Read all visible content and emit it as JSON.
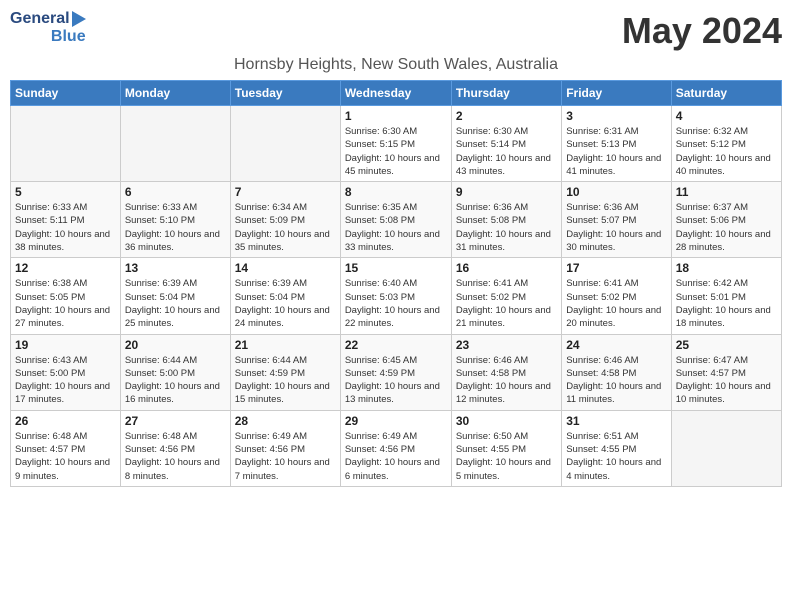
{
  "header": {
    "logo_line1": "General",
    "logo_line2": "Blue",
    "month_title": "May 2024",
    "location": "Hornsby Heights, New South Wales, Australia"
  },
  "weekdays": [
    "Sunday",
    "Monday",
    "Tuesday",
    "Wednesday",
    "Thursday",
    "Friday",
    "Saturday"
  ],
  "weeks": [
    [
      {
        "num": "",
        "empty": true
      },
      {
        "num": "",
        "empty": true
      },
      {
        "num": "",
        "empty": true
      },
      {
        "num": "1",
        "sunrise": "6:30 AM",
        "sunset": "5:15 PM",
        "daylight": "10 hours and 45 minutes."
      },
      {
        "num": "2",
        "sunrise": "6:30 AM",
        "sunset": "5:14 PM",
        "daylight": "10 hours and 43 minutes."
      },
      {
        "num": "3",
        "sunrise": "6:31 AM",
        "sunset": "5:13 PM",
        "daylight": "10 hours and 41 minutes."
      },
      {
        "num": "4",
        "sunrise": "6:32 AM",
        "sunset": "5:12 PM",
        "daylight": "10 hours and 40 minutes."
      }
    ],
    [
      {
        "num": "5",
        "sunrise": "6:33 AM",
        "sunset": "5:11 PM",
        "daylight": "10 hours and 38 minutes."
      },
      {
        "num": "6",
        "sunrise": "6:33 AM",
        "sunset": "5:10 PM",
        "daylight": "10 hours and 36 minutes."
      },
      {
        "num": "7",
        "sunrise": "6:34 AM",
        "sunset": "5:09 PM",
        "daylight": "10 hours and 35 minutes."
      },
      {
        "num": "8",
        "sunrise": "6:35 AM",
        "sunset": "5:08 PM",
        "daylight": "10 hours and 33 minutes."
      },
      {
        "num": "9",
        "sunrise": "6:36 AM",
        "sunset": "5:08 PM",
        "daylight": "10 hours and 31 minutes."
      },
      {
        "num": "10",
        "sunrise": "6:36 AM",
        "sunset": "5:07 PM",
        "daylight": "10 hours and 30 minutes."
      },
      {
        "num": "11",
        "sunrise": "6:37 AM",
        "sunset": "5:06 PM",
        "daylight": "10 hours and 28 minutes."
      }
    ],
    [
      {
        "num": "12",
        "sunrise": "6:38 AM",
        "sunset": "5:05 PM",
        "daylight": "10 hours and 27 minutes."
      },
      {
        "num": "13",
        "sunrise": "6:39 AM",
        "sunset": "5:04 PM",
        "daylight": "10 hours and 25 minutes."
      },
      {
        "num": "14",
        "sunrise": "6:39 AM",
        "sunset": "5:04 PM",
        "daylight": "10 hours and 24 minutes."
      },
      {
        "num": "15",
        "sunrise": "6:40 AM",
        "sunset": "5:03 PM",
        "daylight": "10 hours and 22 minutes."
      },
      {
        "num": "16",
        "sunrise": "6:41 AM",
        "sunset": "5:02 PM",
        "daylight": "10 hours and 21 minutes."
      },
      {
        "num": "17",
        "sunrise": "6:41 AM",
        "sunset": "5:02 PM",
        "daylight": "10 hours and 20 minutes."
      },
      {
        "num": "18",
        "sunrise": "6:42 AM",
        "sunset": "5:01 PM",
        "daylight": "10 hours and 18 minutes."
      }
    ],
    [
      {
        "num": "19",
        "sunrise": "6:43 AM",
        "sunset": "5:00 PM",
        "daylight": "10 hours and 17 minutes."
      },
      {
        "num": "20",
        "sunrise": "6:44 AM",
        "sunset": "5:00 PM",
        "daylight": "10 hours and 16 minutes."
      },
      {
        "num": "21",
        "sunrise": "6:44 AM",
        "sunset": "4:59 PM",
        "daylight": "10 hours and 15 minutes."
      },
      {
        "num": "22",
        "sunrise": "6:45 AM",
        "sunset": "4:59 PM",
        "daylight": "10 hours and 13 minutes."
      },
      {
        "num": "23",
        "sunrise": "6:46 AM",
        "sunset": "4:58 PM",
        "daylight": "10 hours and 12 minutes."
      },
      {
        "num": "24",
        "sunrise": "6:46 AM",
        "sunset": "4:58 PM",
        "daylight": "10 hours and 11 minutes."
      },
      {
        "num": "25",
        "sunrise": "6:47 AM",
        "sunset": "4:57 PM",
        "daylight": "10 hours and 10 minutes."
      }
    ],
    [
      {
        "num": "26",
        "sunrise": "6:48 AM",
        "sunset": "4:57 PM",
        "daylight": "10 hours and 9 minutes."
      },
      {
        "num": "27",
        "sunrise": "6:48 AM",
        "sunset": "4:56 PM",
        "daylight": "10 hours and 8 minutes."
      },
      {
        "num": "28",
        "sunrise": "6:49 AM",
        "sunset": "4:56 PM",
        "daylight": "10 hours and 7 minutes."
      },
      {
        "num": "29",
        "sunrise": "6:49 AM",
        "sunset": "4:56 PM",
        "daylight": "10 hours and 6 minutes."
      },
      {
        "num": "30",
        "sunrise": "6:50 AM",
        "sunset": "4:55 PM",
        "daylight": "10 hours and 5 minutes."
      },
      {
        "num": "31",
        "sunrise": "6:51 AM",
        "sunset": "4:55 PM",
        "daylight": "10 hours and 4 minutes."
      },
      {
        "num": "",
        "empty": true
      }
    ]
  ]
}
